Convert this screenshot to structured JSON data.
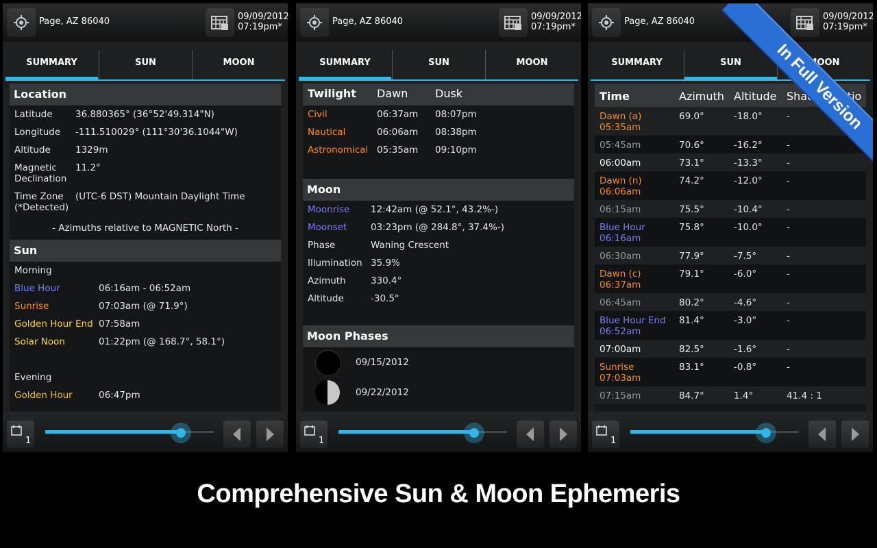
{
  "header": {
    "location": "Page, AZ 86040",
    "date": "09/09/2012",
    "time": "07:19pm*"
  },
  "tabs": [
    "SUMMARY",
    "SUN",
    "MOON"
  ],
  "footer": {
    "day_count": "1",
    "slider_value": 0.8
  },
  "summary": {
    "location_title": "Location",
    "rows": [
      {
        "k": "Latitude",
        "v": "36.880365° (36°52'49.314\"N)"
      },
      {
        "k": "Longitude",
        "v": "-111.510029° (111°30'36.1044\"W)"
      },
      {
        "k": "Altitude",
        "v": "1329m"
      },
      {
        "k": "Magnetic Declination",
        "v": "11.2°"
      },
      {
        "k": "Time Zone (*Detected)",
        "v": "(UTC-6 DST) Mountain Daylight Time"
      }
    ],
    "azimuth_note": "- Azimuths relative to MAGNETIC North -",
    "sun_title": "Sun",
    "morning": "Morning",
    "sun_rows": [
      {
        "k": "Blue Hour",
        "v": "06:16am - 06:52am",
        "c": "blue"
      },
      {
        "k": "Sunrise",
        "v": "07:03am (@ 71.9°)",
        "c": "orange"
      },
      {
        "k": "Golden Hour End",
        "v": "07:58am",
        "c": "yellow"
      },
      {
        "k": "Solar Noon",
        "v": "01:22pm (@ 168.7°, 58.1°)",
        "c": "yellow"
      }
    ],
    "evening": "Evening",
    "evening_rows": [
      {
        "k": "Golden Hour",
        "v": "06:47pm",
        "c": "gold"
      }
    ]
  },
  "panel2": {
    "twilight": {
      "title": "Twilight",
      "dawn": "Dawn",
      "dusk": "Dusk",
      "rows": [
        {
          "k": "Civil",
          "dawn": "06:37am",
          "dusk": "08:07pm"
        },
        {
          "k": "Nautical",
          "dawn": "06:06am",
          "dusk": "08:38pm"
        },
        {
          "k": "Astronomical",
          "dawn": "05:35am",
          "dusk": "09:10pm"
        }
      ]
    },
    "moon": {
      "title": "Moon",
      "rows": [
        {
          "k": "Moonrise",
          "v": "12:42am (@ 52.1°, 43.2%-)",
          "c": "blue"
        },
        {
          "k": "Moonset",
          "v": "03:23pm (@ 284.8°, 37.4%-)",
          "c": "blue"
        },
        {
          "k": "Phase",
          "v": "Waning Crescent",
          "c": ""
        },
        {
          "k": "Illumination",
          "v": "35.9%",
          "c": ""
        },
        {
          "k": "Azimuth",
          "v": "330.4°",
          "c": ""
        },
        {
          "k": "Altitude",
          "v": "-30.5°",
          "c": ""
        }
      ]
    },
    "phases": {
      "title": "Moon Phases",
      "items": [
        {
          "date": "09/15/2012",
          "phase": "new"
        },
        {
          "date": "09/22/2012",
          "phase": "first-quarter"
        }
      ]
    }
  },
  "panel3": {
    "cols": [
      "Time",
      "Azimuth",
      "Altitude",
      "Shadow Ratio"
    ],
    "rows": [
      {
        "t1": "Dawn (a)",
        "t2": "05:35am",
        "c": "orange",
        "az": "69.0°",
        "alt": "-18.0°",
        "sh": "-"
      },
      {
        "t1": "05:45am",
        "t2": "",
        "c": "grey",
        "az": "70.6°",
        "alt": "-16.2°",
        "sh": "-"
      },
      {
        "t1": "06:00am",
        "t2": "",
        "c": "white",
        "az": "73.1°",
        "alt": "-13.3°",
        "sh": "-"
      },
      {
        "t1": "Dawn (n)",
        "t2": "06:06am",
        "c": "orange",
        "az": "74.2°",
        "alt": "-12.0°",
        "sh": "-"
      },
      {
        "t1": "06:15am",
        "t2": "",
        "c": "grey",
        "az": "75.5°",
        "alt": "-10.4°",
        "sh": "-"
      },
      {
        "t1": "Blue Hour",
        "t2": "06:16am",
        "c": "blue",
        "az": "75.8°",
        "alt": "-10.0°",
        "sh": "-"
      },
      {
        "t1": "06:30am",
        "t2": "",
        "c": "grey",
        "az": "77.9°",
        "alt": "-7.5°",
        "sh": "-"
      },
      {
        "t1": "Dawn (c)",
        "t2": "06:37am",
        "c": "orange",
        "az": "79.1°",
        "alt": "-6.0°",
        "sh": "-"
      },
      {
        "t1": "06:45am",
        "t2": "",
        "c": "grey",
        "az": "80.2°",
        "alt": "-4.6°",
        "sh": "-"
      },
      {
        "t1": "Blue Hour End",
        "t2": "06:52am",
        "c": "blue",
        "az": "81.4°",
        "alt": "-3.0°",
        "sh": "-"
      },
      {
        "t1": "07:00am",
        "t2": "",
        "c": "white",
        "az": "82.5°",
        "alt": "-1.6°",
        "sh": "-"
      },
      {
        "t1": "Sunrise",
        "t2": "07:03am",
        "c": "orange",
        "az": "83.1°",
        "alt": "-0.8°",
        "sh": "-"
      },
      {
        "t1": "07:15am",
        "t2": "",
        "c": "grey",
        "az": "84.7°",
        "alt": "1.4°",
        "sh": "41.4 : 1"
      }
    ]
  },
  "ribbon": "In Full Version",
  "caption": "Comprehensive Sun & Moon Ephemeris",
  "colors": {
    "accent": "#33b5e5",
    "blue_label": "#7b7bff",
    "orange_label": "#ff8c1a",
    "yellow_label": "#ffd633",
    "ribbon": "#2a6fd6"
  }
}
